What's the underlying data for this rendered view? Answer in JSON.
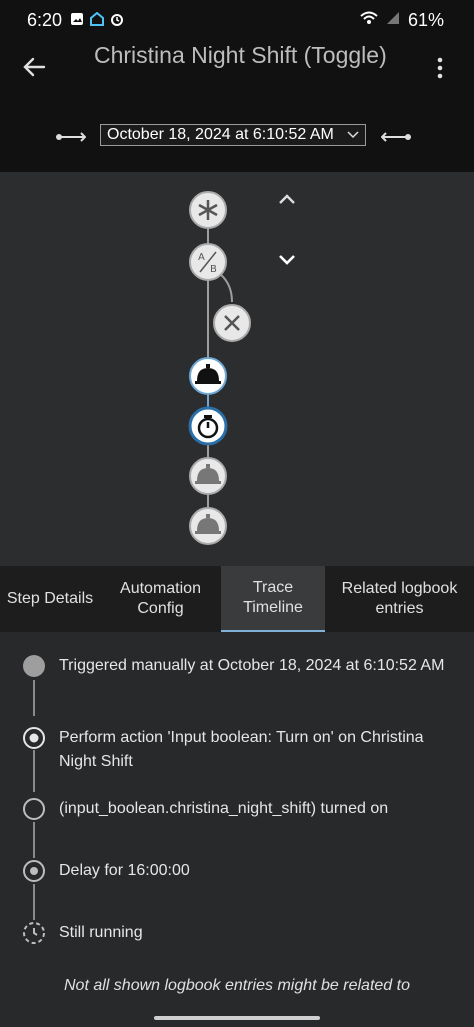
{
  "status_bar": {
    "time": "6:20",
    "battery": "61%",
    "icons": [
      "gallery-icon",
      "google-home-icon",
      "alarm-icon",
      "wifi-icon",
      "signal-icon"
    ]
  },
  "header": {
    "title": "Christina Night Shift (Toggle)",
    "date_value": "October 18, 2024 at 6:10:52 AM"
  },
  "graph": {
    "nodes": [
      "trigger-node",
      "condition-node",
      "condition-fail-node",
      "action-node",
      "delay-node",
      "action-node-2",
      "action-node-3"
    ]
  },
  "tabs": [
    {
      "label": "Step Details"
    },
    {
      "label": "Automation Config"
    },
    {
      "label": "Trace Timeline"
    },
    {
      "label": "Related logbook entries"
    }
  ],
  "timeline": [
    {
      "text": "Triggered manually at October 18, 2024 at 6:10:52 AM"
    },
    {
      "text": "Perform action 'Input boolean: Turn on' on Christina Night Shift"
    },
    {
      "text": "(input_boolean.christina_night_shift) turned on"
    },
    {
      "text": "Delay for 16:00:00"
    },
    {
      "text": "Still running"
    }
  ],
  "note": "Not all shown logbook entries might be related to",
  "colors": {
    "accent": "#7fb2d8",
    "node_fill": "#e6e6e6",
    "active_node": "#ffffff",
    "background": "#1c1c1c"
  }
}
